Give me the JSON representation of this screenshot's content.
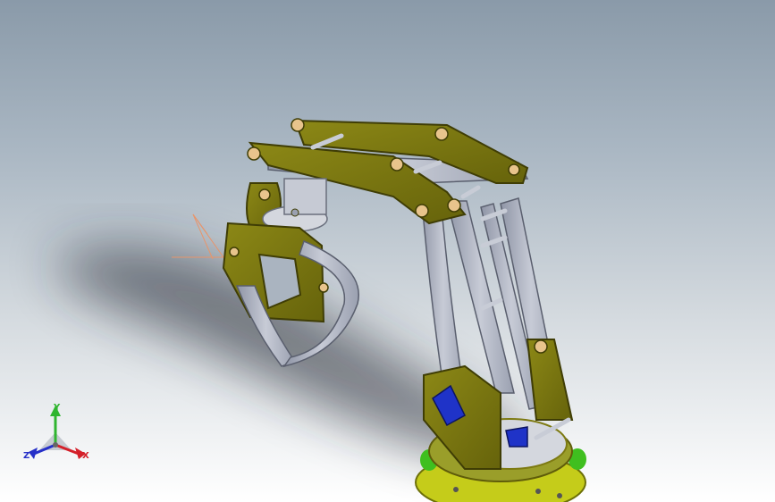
{
  "viewport": {
    "colors": {
      "background_top": "#8a9aa9",
      "background_bottom": "#ffffff",
      "arm_plate": "#7d7a12",
      "arm_plate_dark": "#5f5c0a",
      "link_grey": "#b8bcc8",
      "link_grey_dark": "#8d93a3",
      "servo_blue": "#1f33c8",
      "base_green": "#3fbf1f",
      "sketch_orange": "#e8956b"
    },
    "model": {
      "parts": [
        "gripper",
        "wrist-plate",
        "upper-arm-links",
        "forearm-links",
        "servo-motor",
        "rotating-base"
      ]
    }
  },
  "triad": {
    "x_label": "X",
    "y_label": "Y",
    "z_label": "Z",
    "x_color": "#d4202a",
    "y_color": "#2fb52f",
    "z_color": "#2630c8"
  }
}
